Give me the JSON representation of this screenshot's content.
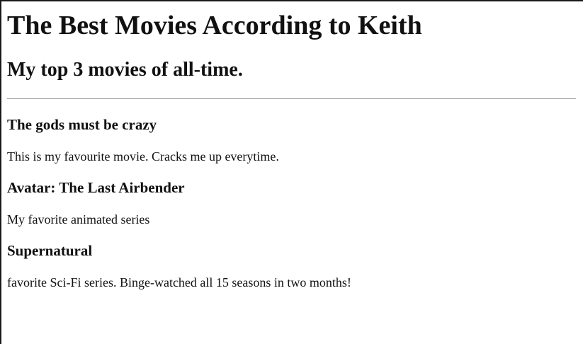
{
  "page": {
    "title": "The Best Movies According to Keith",
    "subtitle": "My top 3 movies of all-time."
  },
  "movies": [
    {
      "title": "The gods must be crazy",
      "description": "This is my favourite movie. Cracks me up everytime."
    },
    {
      "title": "Avatar: The Last Airbender",
      "description": "My favorite animated series"
    },
    {
      "title": "Supernatural",
      "description": "favorite Sci-Fi series. Binge-watched all 15 seasons in two months!"
    }
  ]
}
